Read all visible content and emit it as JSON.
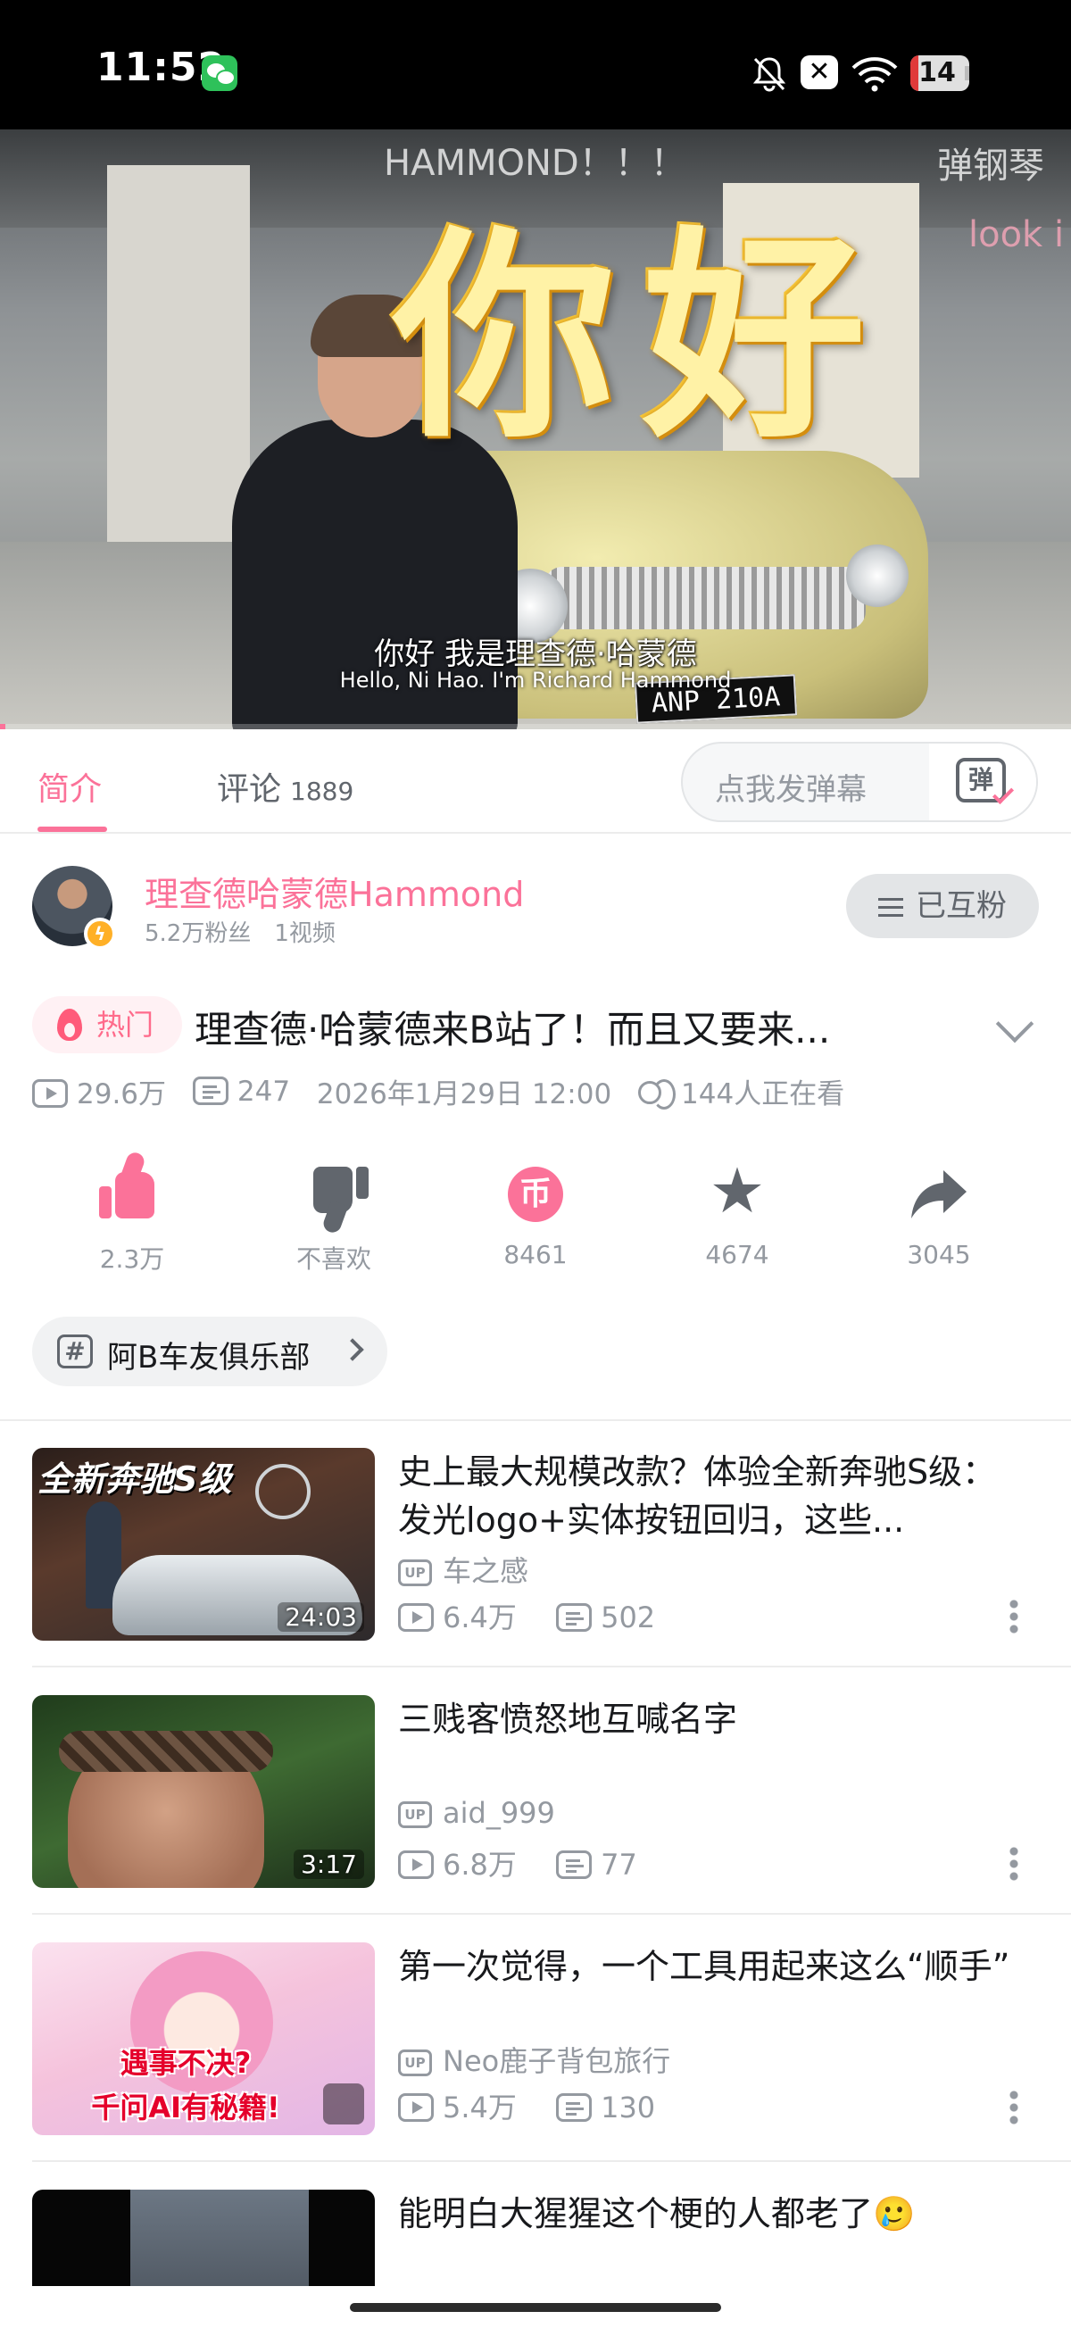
{
  "status_bar": {
    "time": "11:52",
    "battery_level": "14",
    "battery_fraction": 0.14,
    "notification_icons": [
      "wechat-icon"
    ],
    "system_icons": [
      "bell-muted-icon",
      "close-box-icon",
      "wifi-icon",
      "battery-icon"
    ]
  },
  "player": {
    "overlay_text": "你好",
    "danmaku": [
      "HAMMOND！！！",
      "弹钢琴",
      "look i"
    ],
    "subtitle_cn": "你好 我是理查德·哈蒙德",
    "subtitle_en": "Hello, Ni Hao. I'm Richard Hammond",
    "license_plate": "ANP 210A",
    "progress_fraction": 0.005
  },
  "tabs": {
    "intro": "简介",
    "comments": "评论",
    "comments_count": "1889",
    "danmaku_placeholder": "点我发弹幕",
    "danmaku_button": "弹"
  },
  "uploader": {
    "name": "理查德哈蒙德Hammond",
    "followers": "5.2万粉丝",
    "videos": "1视频",
    "follow_state": "已互粉"
  },
  "video": {
    "hot_badge": "热门",
    "title": "理查德·哈蒙德来B站了！而且又要来...",
    "views": "29.6万",
    "danmaku_count": "247",
    "publish_time": "2026年1月29日 12:00",
    "watching": "144人正在看"
  },
  "actions": {
    "like": "2.3万",
    "dislike": "不喜欢",
    "coin": "8461",
    "favorite": "4674",
    "share": "3045",
    "coin_glyph": "币",
    "fav_glyph": "★"
  },
  "tag": {
    "label": "阿B车友俱乐部",
    "hash_glyph": "#"
  },
  "related": [
    {
      "title": "史上最大规模改款？体验全新奔驰S级：发光logo+实体按钮回归，这些...",
      "up": "车之感",
      "views": "6.4万",
      "danmaku": "502",
      "duration": "24:03",
      "thumb_caption": "全新奔驰S级"
    },
    {
      "title": "三贱客愤怒地互喊名字",
      "up": "aid_999",
      "views": "6.8万",
      "danmaku": "77",
      "duration": "3:17"
    },
    {
      "title": "第一次觉得，一个工具用起来这么“顺手”",
      "up": "Neo鹿子背包旅行",
      "views": "5.4万",
      "danmaku": "130",
      "thumb_caption_1": "遇事不决?",
      "thumb_caption_2": "千问AI有秘籍!"
    },
    {
      "title": "能明白大猩猩这个梗的人都老了🥲"
    }
  ],
  "up_badge": "UP",
  "colors": {
    "accent": "#fb7299",
    "text_primary": "#18191c",
    "text_secondary": "#9499a0",
    "icon_gray": "#61666d"
  }
}
